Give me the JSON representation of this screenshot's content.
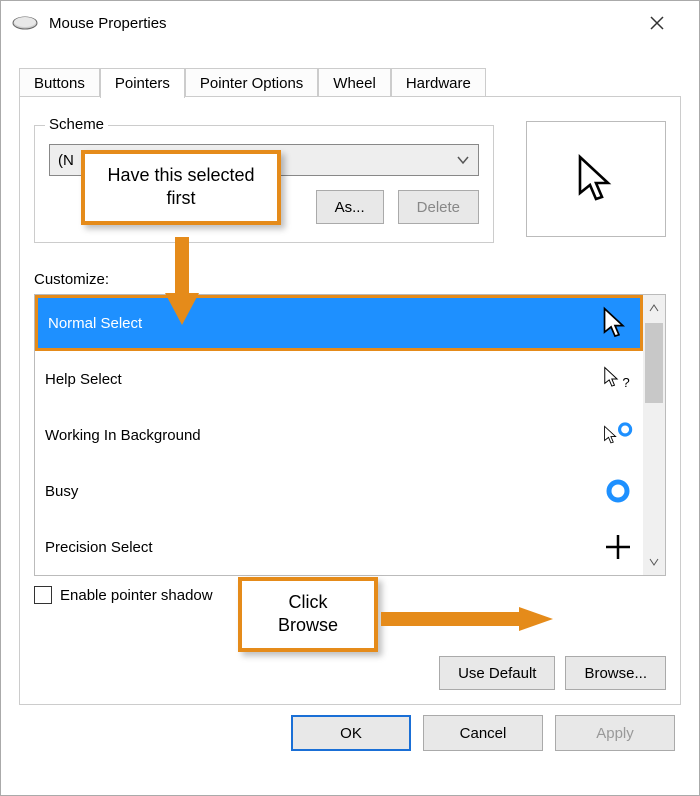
{
  "window": {
    "title": "Mouse Properties"
  },
  "tabs": [
    {
      "label": "Buttons"
    },
    {
      "label": "Pointers",
      "active": true
    },
    {
      "label": "Pointer Options"
    },
    {
      "label": "Wheel"
    },
    {
      "label": "Hardware"
    }
  ],
  "scheme": {
    "legend": "Scheme",
    "selected": "(N",
    "save_label": " As...",
    "delete_label": "Delete"
  },
  "customize": {
    "label": "Customize:",
    "items": [
      {
        "name": "Normal Select",
        "selected": true,
        "icon": "arrow"
      },
      {
        "name": "Help Select",
        "icon": "arrow-help"
      },
      {
        "name": "Working In Background",
        "icon": "arrow-busy"
      },
      {
        "name": "Busy",
        "icon": "busy"
      },
      {
        "name": "Precision Select",
        "icon": "precision"
      }
    ]
  },
  "shadow": {
    "label": "Enable pointer shadow"
  },
  "buttons": {
    "use_default": "Use Default",
    "browse": "Browse..."
  },
  "footer": {
    "ok": "OK",
    "cancel": "Cancel",
    "apply": "Apply"
  },
  "callouts": {
    "first": "Have this selected first",
    "second": "Click Browse"
  }
}
